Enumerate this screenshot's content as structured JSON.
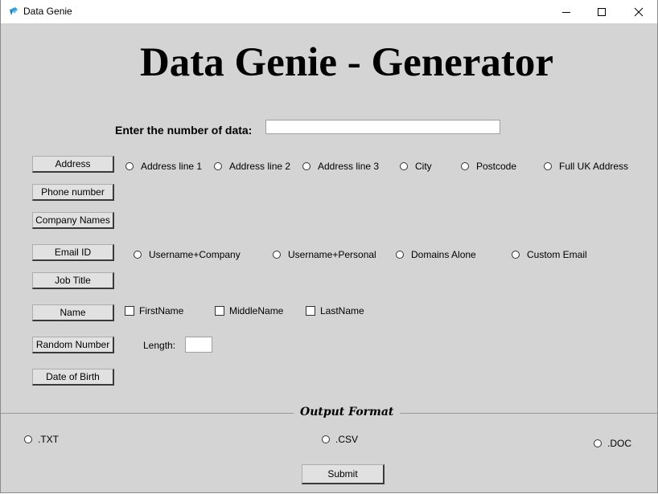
{
  "window": {
    "title": "Data Genie"
  },
  "heading": "Data Genie - Generator",
  "count": {
    "label": "Enter the number of data:",
    "value": ""
  },
  "address": {
    "button": "Address",
    "options": [
      "Address line 1",
      "Address line 2",
      "Address line 3",
      "City",
      "Postcode",
      "Full UK Address"
    ]
  },
  "phone": {
    "button": "Phone number"
  },
  "company": {
    "button": "Company Names"
  },
  "email": {
    "button": "Email ID",
    "options": [
      "Username+Company",
      "Username+Personal",
      "Domains Alone",
      "Custom Email"
    ]
  },
  "job": {
    "button": "Job Title"
  },
  "name": {
    "button": "Name",
    "options": [
      "FirstName",
      "MiddleName",
      "LastName"
    ]
  },
  "random": {
    "button": "Random Number",
    "length_label": "Length:",
    "length_value": ""
  },
  "dob": {
    "button": "Date of Birth"
  },
  "output": {
    "label": "Output Format",
    "options": [
      ".TXT",
      ".CSV",
      ".DOC"
    ]
  },
  "submit": "Submit"
}
